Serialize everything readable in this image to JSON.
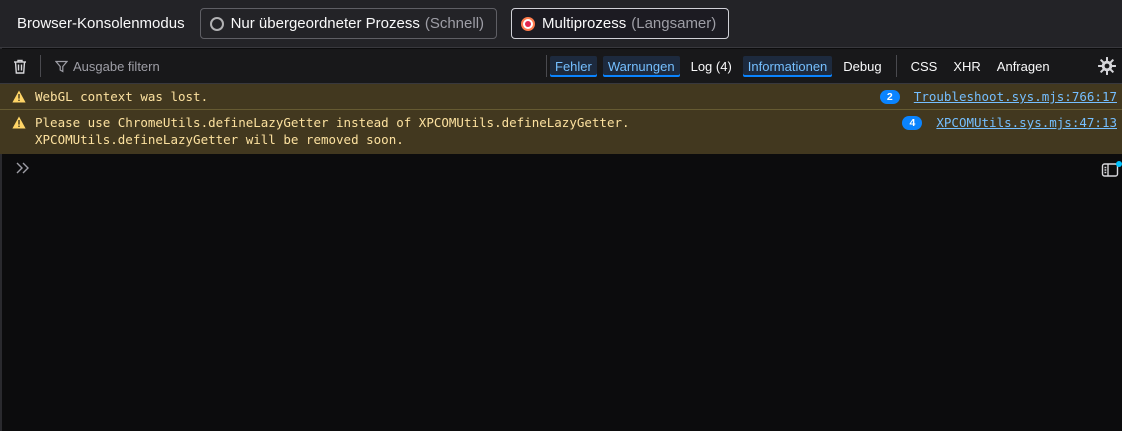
{
  "modebar": {
    "label": "Browser-Konsolenmodus",
    "options": [
      {
        "name": "Nur übergeordneter Prozess",
        "hint": "(Schnell)",
        "selected": false
      },
      {
        "name": "Multiprozess",
        "hint": "(Langsamer)",
        "selected": true
      }
    ]
  },
  "toolbar": {
    "filter_placeholder": "Ausgabe filtern",
    "filters": [
      {
        "label": "Fehler",
        "checked": true
      },
      {
        "label": "Warnungen",
        "checked": true
      },
      {
        "label": "Log (4)",
        "checked": false
      },
      {
        "label": "Informationen",
        "checked": true
      },
      {
        "label": "Debug",
        "checked": false
      }
    ],
    "net_filters": [
      {
        "label": "CSS"
      },
      {
        "label": "XHR"
      },
      {
        "label": "Anfragen"
      }
    ]
  },
  "messages": [
    {
      "level": "warning",
      "text": "WebGL context was lost.",
      "repeat": "2",
      "source": "Troubleshoot.sys.mjs:766:17"
    },
    {
      "level": "warning",
      "text": "Please use ChromeUtils.defineLazyGetter instead of XPCOMUtils.defineLazyGetter.\nXPCOMUtils.defineLazyGetter will be removed soon.",
      "repeat": "4",
      "source": "XPCOMUtils.sys.mjs:47:13"
    }
  ],
  "icons": {
    "trash": "trash-icon",
    "filter": "funnel-icon",
    "settings": "gear-icon",
    "warning": "warning-triangle-icon",
    "prompt": "double-chevron-right-icon",
    "editor": "split-editor-icon"
  },
  "colors": {
    "warning_bg": "#42381f",
    "warning_text": "#fce19f",
    "link": "#75bfff",
    "accent": "#0a84ff"
  }
}
